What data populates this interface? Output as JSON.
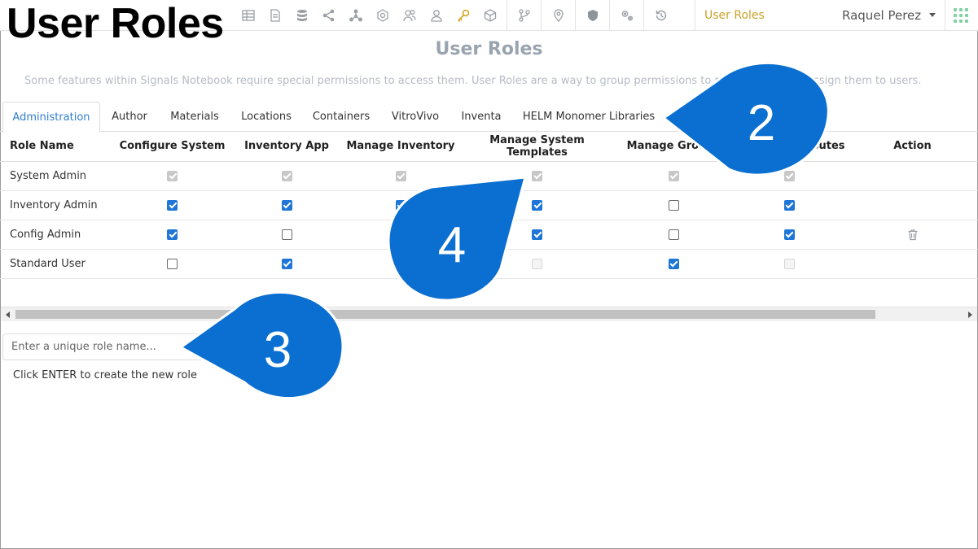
{
  "overlay_title": "User Roles",
  "topbar": {
    "icons": [
      "table-icon",
      "document-icon",
      "database-icon",
      "share-icon",
      "network-icon",
      "molecule-icon",
      "users-icon",
      "user-icon",
      "key-icon",
      "box-icon",
      "git-branch-icon",
      "location-pin-icon",
      "shield-icon",
      "gears-icon",
      "history-icon"
    ],
    "active_section": "User Roles",
    "user_name": "Raquel Perez"
  },
  "page": {
    "heading": "User Roles",
    "intro": "Some features within Signals Notebook require special permissions to access them. User Roles are a way to group permissions to make it easier to assign them to users."
  },
  "tabs": [
    {
      "label": "Administration",
      "active": true
    },
    {
      "label": "Author",
      "active": false
    },
    {
      "label": "Materials",
      "active": false
    },
    {
      "label": "Locations",
      "active": false
    },
    {
      "label": "Containers",
      "active": false
    },
    {
      "label": "VitroVivo",
      "active": false
    },
    {
      "label": "Inventa",
      "active": false
    },
    {
      "label": "HELM Monomer Libraries",
      "active": false
    }
  ],
  "table": {
    "columns": [
      "Role Name",
      "Configure System",
      "Inventory App",
      "Manage Inventory",
      "Manage System Templates",
      "Manage Groups",
      "Manage Attributes",
      "Action"
    ],
    "rows": [
      {
        "name": "System Admin",
        "cells": [
          "dis-on",
          "dis-on",
          "dis-on",
          "dis-on",
          "dis-on",
          "dis-on"
        ],
        "deletable": false
      },
      {
        "name": "Inventory Admin",
        "cells": [
          "on",
          "on",
          "on",
          "on",
          "off",
          "on"
        ],
        "deletable": false
      },
      {
        "name": "Config Admin",
        "cells": [
          "on",
          "off",
          "off",
          "on",
          "off",
          "on"
        ],
        "deletable": true
      },
      {
        "name": "Standard User",
        "cells": [
          "off",
          "on",
          "dis-off",
          "dis-off",
          "on",
          "dis-off"
        ],
        "deletable": false
      }
    ]
  },
  "new_role": {
    "placeholder": "Enter a unique role name...",
    "hint": "Click ENTER to create the new role"
  },
  "callouts": {
    "c2": "2",
    "c3": "3",
    "c4": "4"
  },
  "colors": {
    "callout": "#0a6fd1",
    "accent": "#2f7fd0",
    "active_section": "#c9a227"
  }
}
